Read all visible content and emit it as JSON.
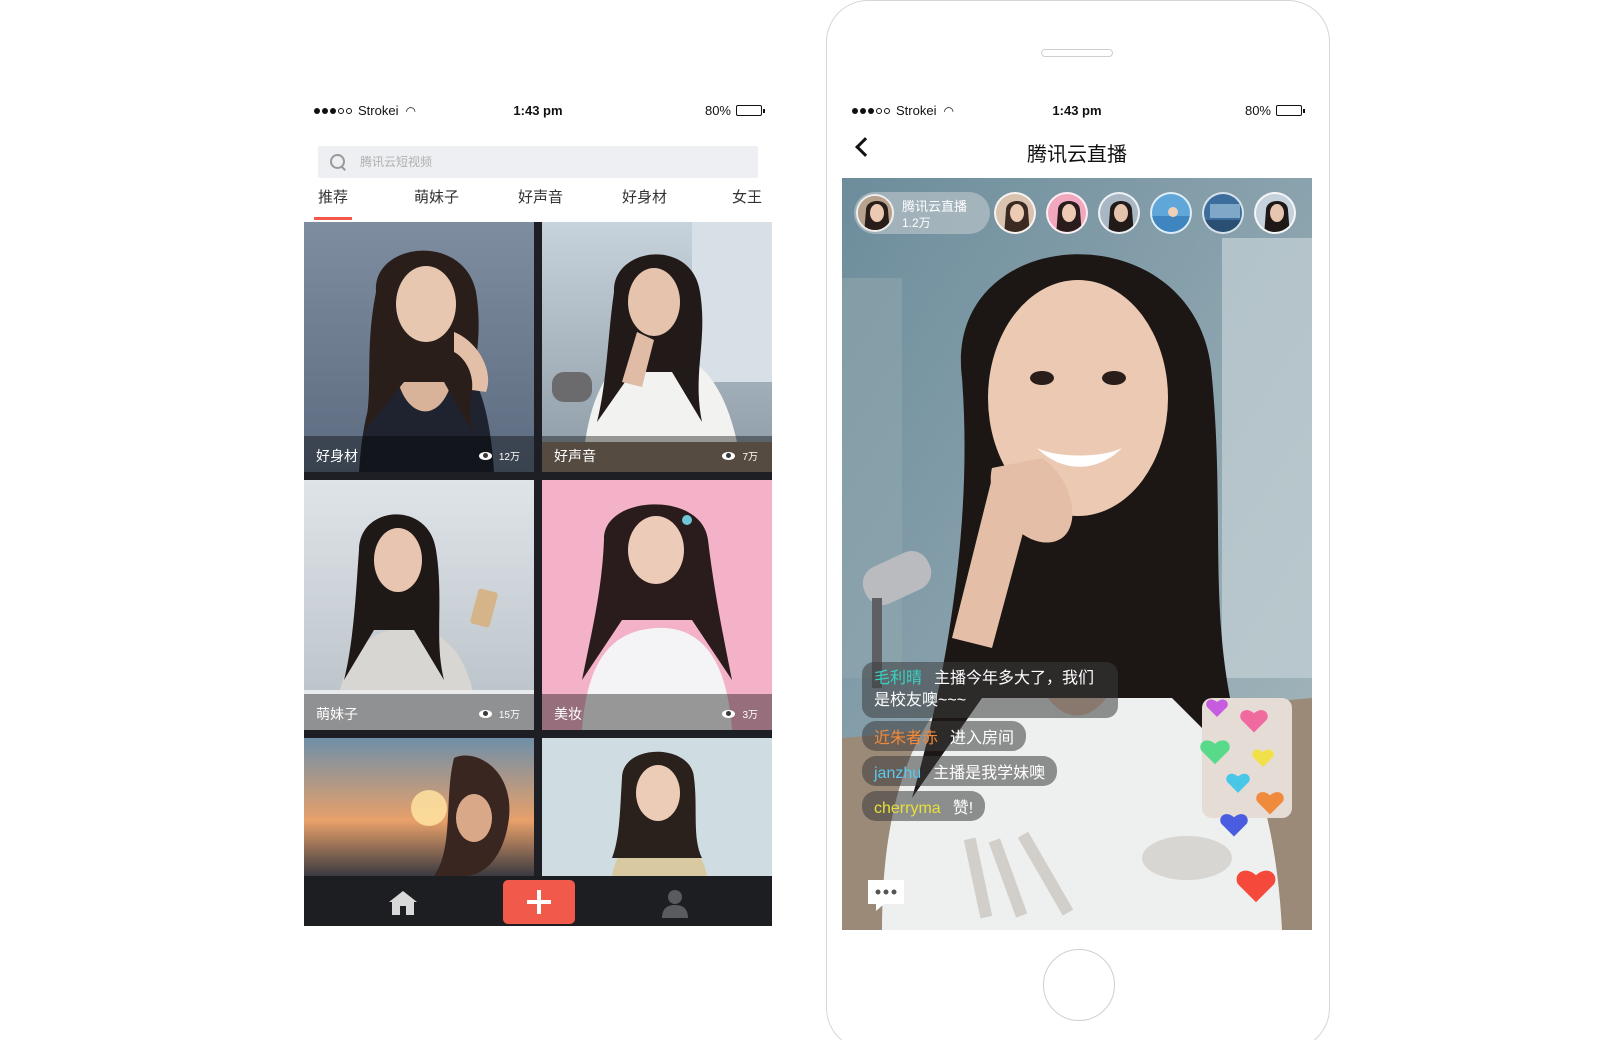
{
  "left_screen": {
    "status": {
      "carrier": "Strokei",
      "time": "1:43 pm",
      "battery": "80%"
    },
    "search": {
      "placeholder": "腾讯云短视频"
    },
    "tabs": [
      "推荐",
      "萌妹子",
      "好声音",
      "好身材",
      "女王"
    ],
    "active_tab": 0,
    "cards": [
      {
        "label": "好身材",
        "views": "12万"
      },
      {
        "label": "好声音",
        "views": "7万"
      },
      {
        "label": "萌妹子",
        "views": "15万"
      },
      {
        "label": "美妆",
        "views": "3万"
      }
    ],
    "tabbar": {
      "home": "home-icon",
      "add": "plus-icon",
      "profile": "user-icon"
    },
    "colors": {
      "accent": "#f15a4a",
      "tabbar": "#1d1e22"
    }
  },
  "right_screen": {
    "status": {
      "carrier": "Strokei",
      "time": "1:43 pm",
      "battery": "80%"
    },
    "title": "腾讯云直播",
    "host": {
      "name": "腾讯云直播",
      "count": "1.2万"
    },
    "viewer_count": 6,
    "messages": [
      {
        "user": "毛利晴",
        "text": "主播今年多大了，我们是校友噢~~~",
        "color": "#39d3c4"
      },
      {
        "user": "近朱者赤",
        "text": "进入房间",
        "color": "#f08a3c"
      },
      {
        "user": "janzhu",
        "text": "主播是我学妹噢",
        "color": "#5ac8f0"
      },
      {
        "user": "cherryma",
        "text": "赞!",
        "color": "#e6e03a"
      }
    ]
  }
}
